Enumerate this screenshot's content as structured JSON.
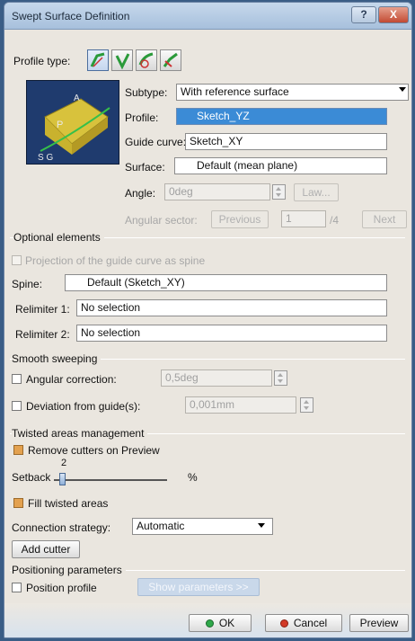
{
  "window": {
    "title": "Swept Surface Definition",
    "help": "?",
    "close": "X"
  },
  "profile_type": {
    "label": "Profile type:",
    "icons": [
      "line-profile-icon",
      "circle-profile-icon",
      "conic-profile-icon",
      "explicit-profile-icon"
    ]
  },
  "fields": {
    "subtype_label": "Subtype:",
    "subtype_value": "With reference surface",
    "profile_label": "Profile:",
    "profile_value": "Sketch_YZ",
    "guide_label": "Guide curve:",
    "guide_value": "Sketch_XY",
    "surface_label": "Surface:",
    "surface_value": "Default (mean plane)",
    "angle_label": "Angle:",
    "angle_value": "0deg",
    "law_button": "Law...",
    "sector_label": "Angular sector:",
    "previous_button": "Previous",
    "sector_value": "1",
    "sector_total": "/4",
    "next_button": "Next"
  },
  "optional": {
    "title": "Optional elements",
    "projection_label": "Projection of the guide curve as spine",
    "spine_label": "Spine:",
    "spine_value": "Default (Sketch_XY)",
    "relim1_label": "Relimiter 1:",
    "relim1_value": "No selection",
    "relim2_label": "Relimiter 2:",
    "relim2_value": "No selection"
  },
  "smooth": {
    "title": "Smooth sweeping",
    "angular_label": "Angular correction:",
    "angular_value": "0,5deg",
    "deviation_label": "Deviation from guide(s):",
    "deviation_value": "0,001mm"
  },
  "twisted": {
    "title": "Twisted areas management",
    "remove_cutters_label": "Remove cutters on Preview",
    "setback_label": "Setback",
    "setback_value": "2",
    "setback_unit": "%",
    "fill_label": "Fill twisted areas",
    "connection_label": "Connection strategy:",
    "connection_value": "Automatic",
    "add_cutter": "Add cutter"
  },
  "positioning": {
    "title": "Positioning parameters",
    "position_label": "Position profile",
    "show_params": "Show parameters >>"
  },
  "footer": {
    "ok": "OK",
    "cancel": "Cancel",
    "preview": "Preview"
  },
  "colors": {
    "accent_selected": "#3b8bd6",
    "ok_green": "#2fa84a",
    "cancel_red": "#d23a27"
  }
}
